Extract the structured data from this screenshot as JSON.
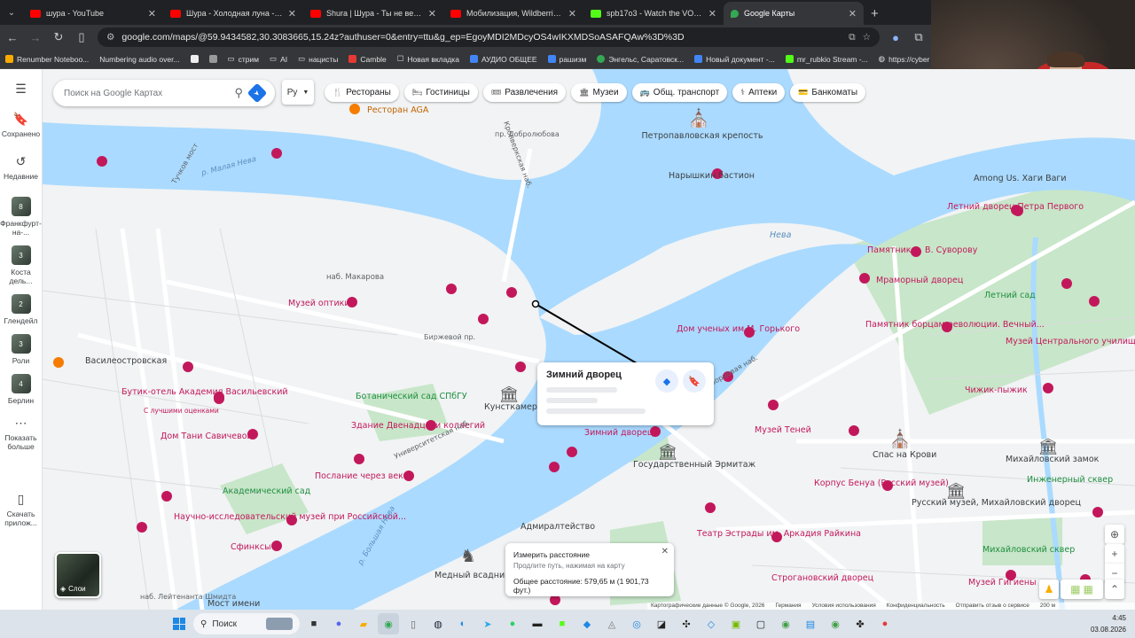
{
  "tabs": [
    {
      "title": "шура - YouTube",
      "favicon": "youtube-icon"
    },
    {
      "title": "Шура - Холодная луна - YouTube",
      "favicon": "youtube-icon"
    },
    {
      "title": "Shura | Шура - Ты не верь сле",
      "favicon": "youtube-icon"
    },
    {
      "title": "Мобилизация, Wildberries, вы",
      "favicon": "youtube-icon"
    },
    {
      "title": "spb17o3 - Watch the VOD on K",
      "favicon": "kick-icon"
    },
    {
      "title": "Google Карты",
      "favicon": "google-maps-icon",
      "active": true
    }
  ],
  "address": {
    "url": "google.com/maps/@59.9434582,30.3083665,15.24z?authuser=0&entry=ttu&g_ep=EgoyMDI2MDcyOS4wIKXMDSoASAFQAw%3D%3D"
  },
  "bookmarks": [
    "Renumber Noteboo...",
    "Numbering audio over...",
    "",
    "",
    "стрим",
    "AI",
    "нацисты",
    "Camble",
    "Новая вкладка",
    "АУДИО ОБЩЕЕ",
    "рашизм",
    "Энгельс, Саратовск...",
    "Новый документ -...",
    "mr_rubkio Stream -...",
    "https://cyber"
  ],
  "rail": [
    {
      "label": "Сохранено",
      "icon": "bookmark-icon"
    },
    {
      "label": "Недавние",
      "icon": "history-icon"
    },
    {
      "label": "Франкфурт-на-...",
      "thumb": "8"
    },
    {
      "label": "Коста дель...",
      "thumb": "3"
    },
    {
      "label": "Глендейл",
      "thumb": "2"
    },
    {
      "label": "Роли",
      "thumb": "3"
    },
    {
      "label": "Берлин",
      "thumb": "4"
    },
    {
      "label": "Показать больше",
      "icon": "more-icon"
    },
    {
      "label": "Скачать прилож...",
      "icon": "phone-icon"
    }
  ],
  "search": {
    "placeholder": "Поиск на Google Картах",
    "lang": "Ру"
  },
  "chips": [
    {
      "label": "Рестораны",
      "icon": "fork-knife-icon"
    },
    {
      "label": "Гостиницы",
      "icon": "bed-icon"
    },
    {
      "label": "Развлечения",
      "icon": "ticket-icon"
    },
    {
      "label": "Музеи",
      "icon": "museum-icon"
    },
    {
      "label": "Общ. транспорт",
      "icon": "bus-icon"
    },
    {
      "label": "Аптеки",
      "icon": "pharmacy-icon"
    },
    {
      "label": "Банкоматы",
      "icon": "atm-icon"
    }
  ],
  "map_labels": {
    "aga": "Ресторан AGA",
    "fortress": "Петропавловская крепость",
    "naryshkin": "Нарышкин бастион",
    "neva": "Нева",
    "among_us": "Among Us. Хаги Ваги",
    "summer_palace_peter": "Летний дворец Петра Первого",
    "suvorov": "Памятник А. В. Суворову",
    "marble_palace": "Мраморный дворец",
    "summer_garden": "Летний сад",
    "revolution_monument": "Памятник борцам революции. Вечный...",
    "applied_art": "Музей Центрального училища...",
    "chizhik": "Чижик-пыжик",
    "optics_museum": "Музей оптики",
    "makarova": "наб. Макарова",
    "scientists": "Дом ученых им М. Горького",
    "vasileostrovskaya": "Василеостровская",
    "hotel_academy": "Бутик-отель Академия Васильевский",
    "hotel_rating": "С лучшими оценками",
    "kunstkamera": "Кунсткамера",
    "botanical": "Ботанический сад СПбГУ",
    "twelve_colleges": "Здание Двенадцати коллегий",
    "dom_tani": "Дом Тани Савичевой",
    "winter_palace": "Зимний дворец",
    "hermitage": "Государственный Эрмитаж",
    "shadow_museum": "Музей Теней",
    "spas": "Спас на Крови",
    "mikhailovsky_castle": "Михайловский замок",
    "benois": "Корпус Бенуа (Русский музей)",
    "russian_museum": "Русский музей, Михайловский дворец",
    "engineering_square": "Инженерный сквер",
    "mikhailovsky_square": "Михайловский сквер",
    "academic_garden": "Академический сад",
    "research_museum": "Научно-исследовательский музей при Российской...",
    "poslanie": "Послание через века",
    "sphinx": "Сфинксы",
    "admiralty": "Адмиралтейство",
    "raikin_theatre": "Театр Эстрады им. Аркадия Райкина",
    "bronze_horseman": "Медный всадник",
    "stroganov": "Строгановский дворец",
    "hygiene_museum": "Музей Гигиены",
    "museum_names": "Мост имени",
    "universitetskaya": "Университетская наб.",
    "dvortsovaya": "Дворцовая наб.",
    "birzhevoy": "Биржевой пр.",
    "malaya_neva": "р. Малая Нева",
    "bolshaya_neva": "р. Большая Нева",
    "kronverkskaya": "Кронверкская наб.",
    "tuchkov": "Тучков мост",
    "dobrolyubova": "пр. Добролюбова",
    "schmidt": "наб. Лейтенанта Шмидта"
  },
  "placecard": {
    "title": "Зимний дворец"
  },
  "measure": {
    "title": "Измерить расстояние",
    "hint": "Продлите путь, нажимая на карту",
    "total": "Общее расстояние: 579,65 м (1 901,73 фут.)"
  },
  "layers_label": "Слои",
  "footer": [
    "Картографические данные © Google, 2026",
    "Германия",
    "Условия использования",
    "Конфиденциальность",
    "Отправить отзыв о сервисе",
    "200 м"
  ],
  "taskbar": {
    "search": "Поиск",
    "time": "4:45",
    "date": "03.08.2026"
  },
  "colors": {
    "water": "#aadaff",
    "land": "#f1f3f4",
    "park": "#c8e6c9",
    "poi": "#c2185b",
    "accent": "#1a73e8"
  }
}
